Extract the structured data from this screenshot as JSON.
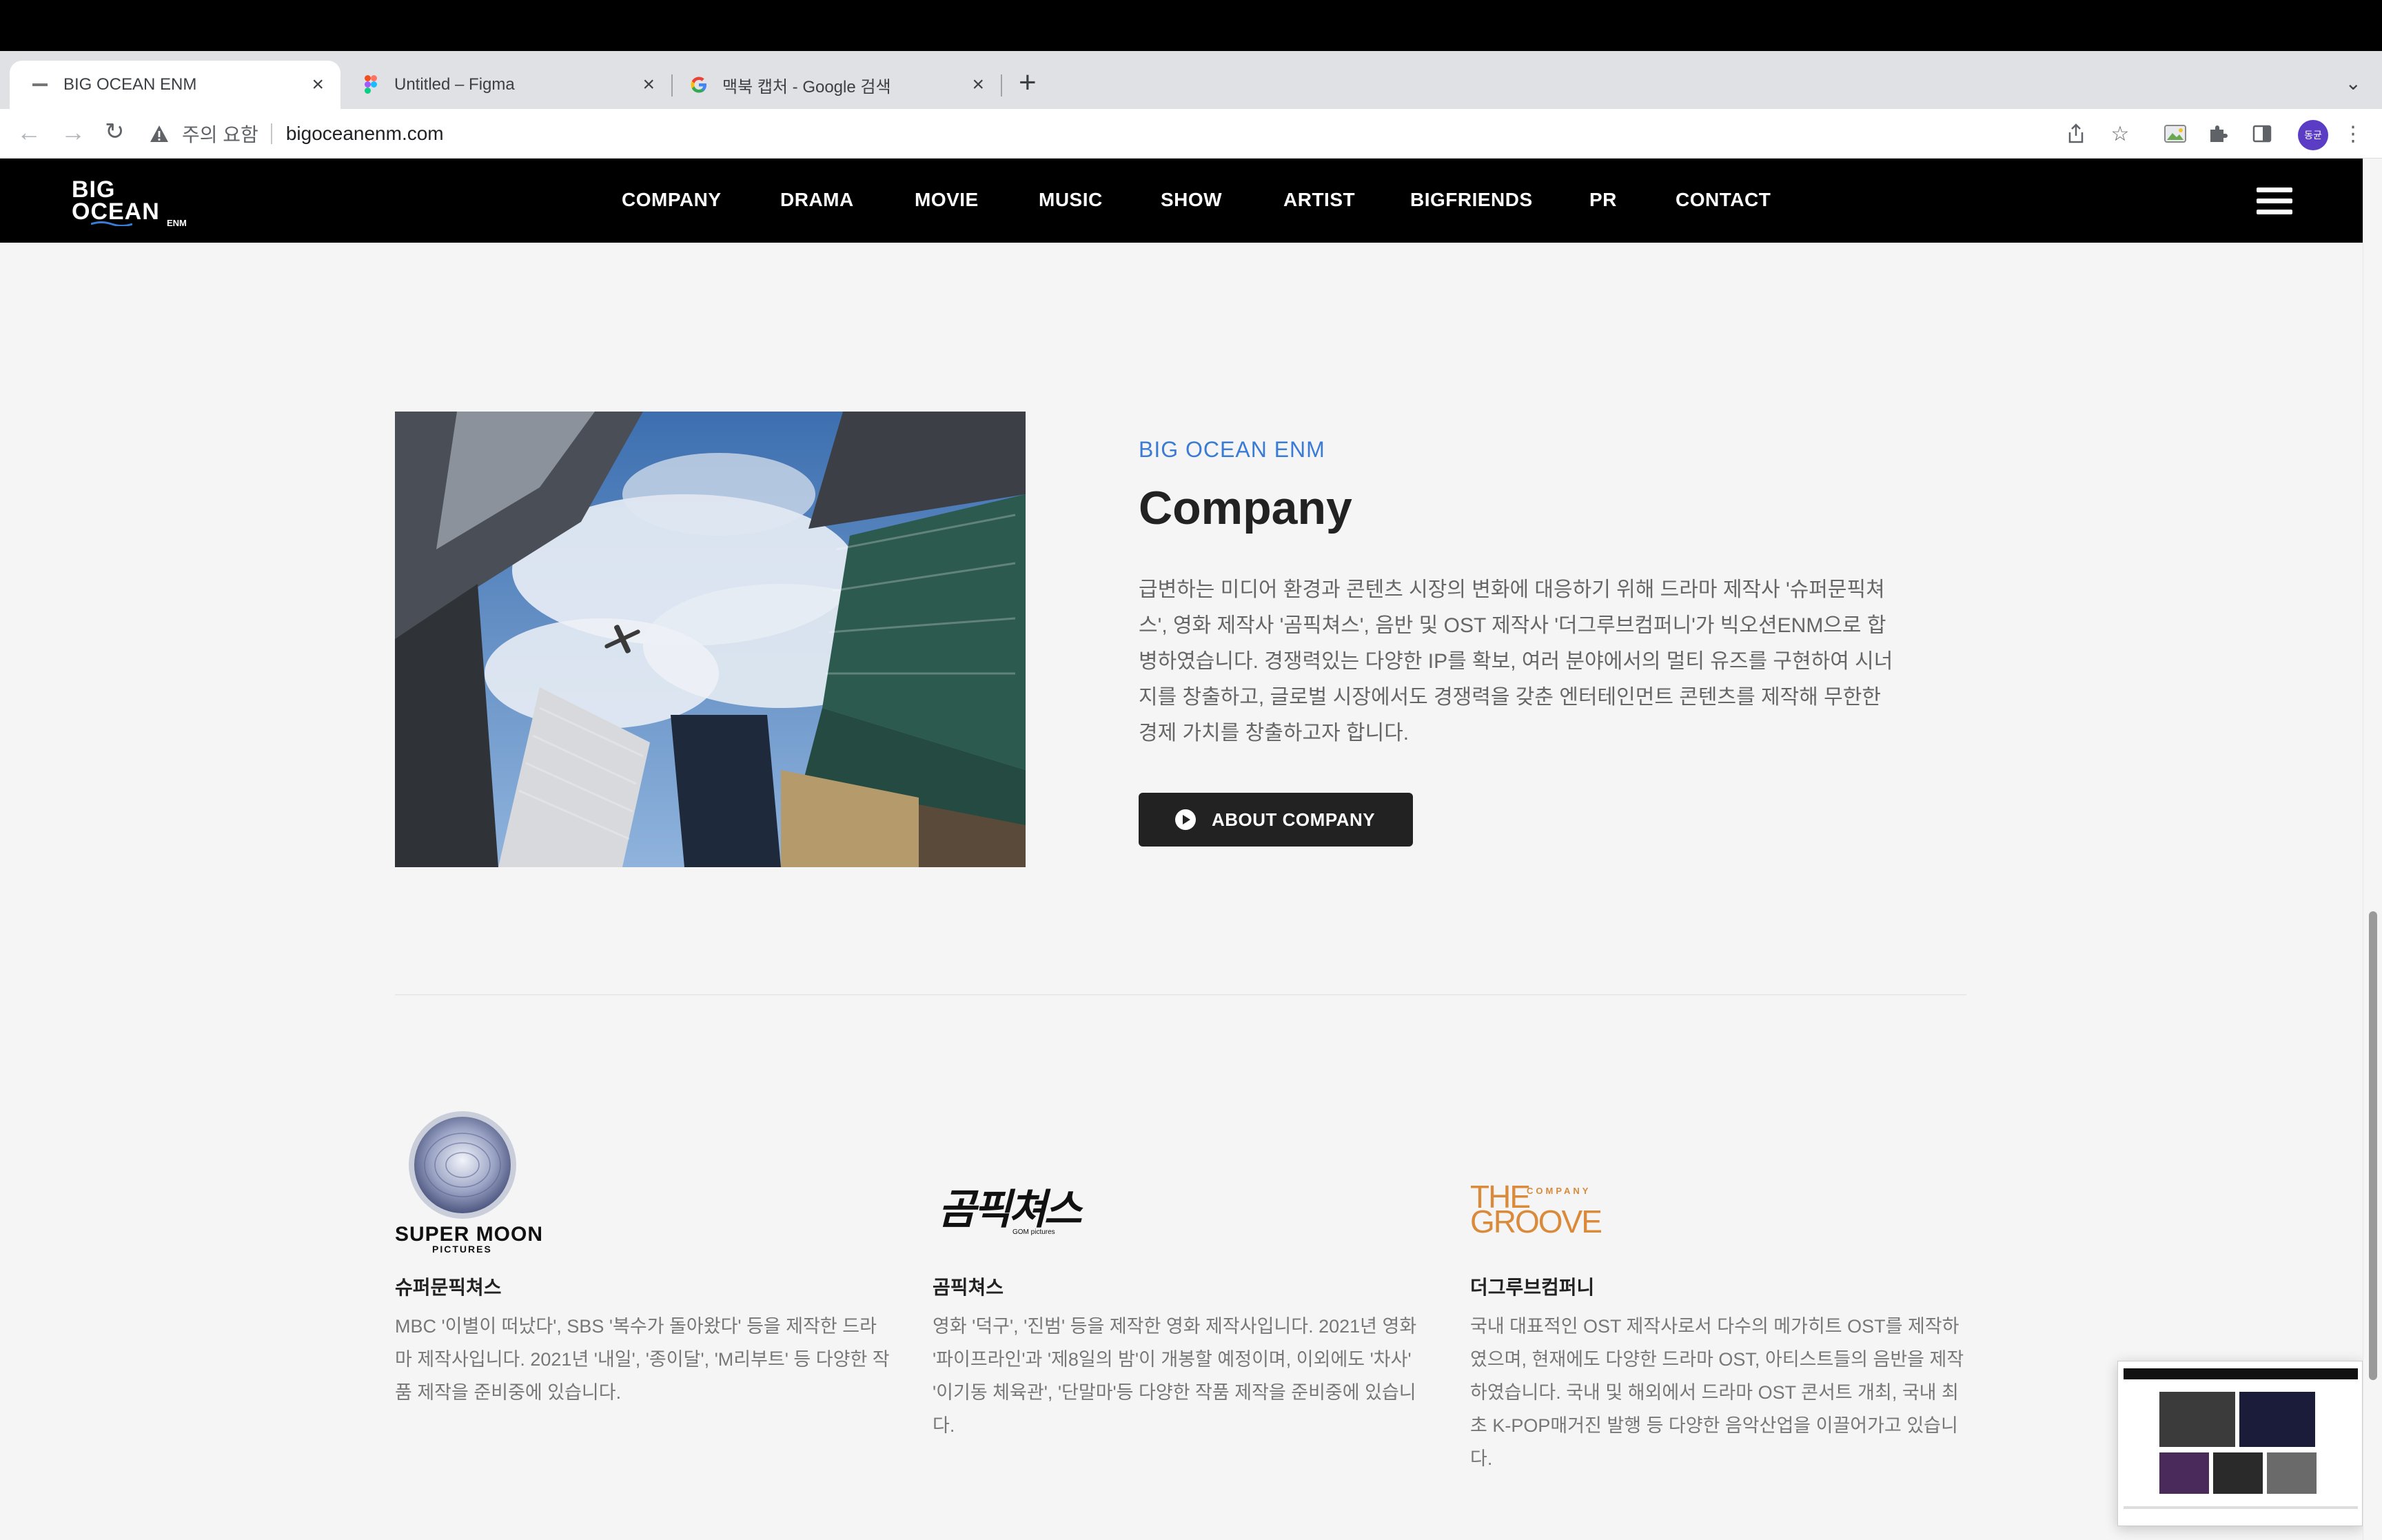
{
  "browser": {
    "tabs": [
      {
        "title": "BIG OCEAN ENM",
        "active": true
      },
      {
        "title": "Untitled – Figma",
        "active": false
      },
      {
        "title": "맥북 캡처 - Google 검색",
        "active": false
      }
    ],
    "security_label": "주의 요함",
    "url": "bigoceanenm.com",
    "profile_initials": "동균"
  },
  "site": {
    "logo": {
      "line1": "BIG",
      "line2": "OCEAN",
      "suffix": "ENM"
    },
    "nav": [
      "COMPANY",
      "DRAMA",
      "MOVIE",
      "MUSIC",
      "SHOW",
      "ARTIST",
      "BIGFRIENDS",
      "PR",
      "CONTACT"
    ]
  },
  "company": {
    "kicker": "BIG OCEAN ENM",
    "title": "Company",
    "description": "급변하는 미디어 환경과 콘텐츠 시장의 변화에 대응하기 위해 드라마 제작사 '슈퍼문픽쳐스', 영화 제작사 '곰픽쳐스', 음반 및 OST 제작사 '더그루브컴퍼니'가 빅오션ENM으로 합병하였습니다. 경쟁력있는 다양한 IP를 확보, 여러 분야에서의 멀티 유즈를 구현하여 시너지를 창출하고, 글로벌 시장에서도 경쟁력을 갖춘 엔터테인먼트 콘텐츠를 제작해 무한한 경제 가치를 창출하고자 합니다.",
    "button": "ABOUT COMPANY"
  },
  "subsidiaries": [
    {
      "name": "슈퍼문픽쳐스",
      "logo_line1": "SUPER MOON",
      "logo_line2": "PICTURES",
      "text": "MBC '이별이 떠났다', SBS '복수가 돌아왔다' 등을 제작한 드라마 제작사입니다. 2021년 '내일', '종이달', 'M리부트' 등 다양한 작품 제작을 준비중에 있습니다."
    },
    {
      "name": "곰픽쳐스",
      "logo_line1": "곰픽쳐스",
      "logo_line2": "GOM pictures",
      "text": "영화 '덕구', '진범' 등을 제작한 영화 제작사입니다. 2021년 영화 '파이프라인'과 '제8일의 밤'이 개봉할 예정이며, 이외에도 '차사' '이기동 체육관', '단말마'등 다양한 작품 제작을 준비중에 있습니다."
    },
    {
      "name": "더그루브컴퍼니",
      "logo_line1": "THE GROOVE",
      "logo_line2": "COMPANY",
      "text": "국내 대표적인 OST 제작사로서 다수의 메가히트 OST를 제작하였으며, 현재에도 다양한 드라마 OST, 아티스트들의 음반을 제작하였습니다. 국내 및 해외에서 드라마 OST 콘서트 개최, 국내 최초 K-POP매거진 발행 등 다양한 음악산업을 이끌어가고 있습니다."
    }
  ],
  "colors": {
    "kicker_blue": "#3a7bd5",
    "groove_orange": "#d98a3a",
    "header_black": "#000000",
    "page_bg": "#f5f5f5"
  }
}
